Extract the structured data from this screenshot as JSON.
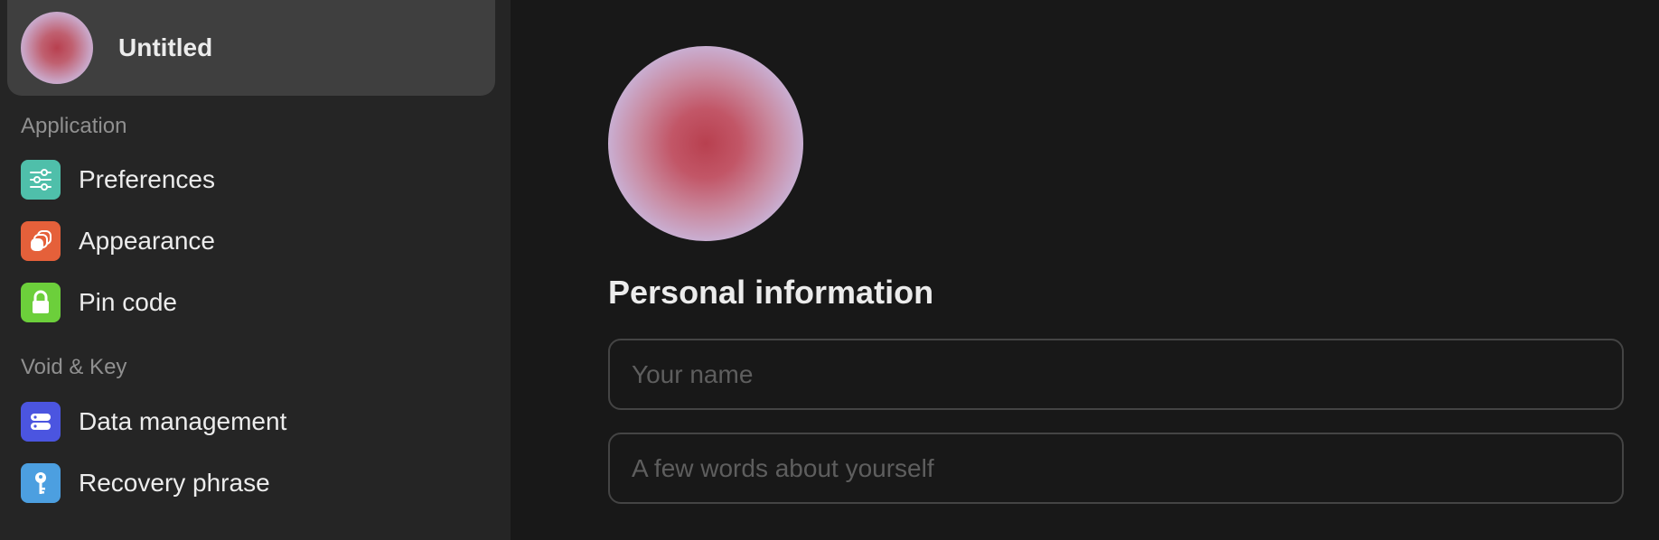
{
  "profile": {
    "name": "Untitled"
  },
  "sidebar": {
    "sections": [
      {
        "title": "Application",
        "items": [
          {
            "label": "Preferences",
            "icon": "sliders-icon",
            "color": "#4fbfaa"
          },
          {
            "label": "Appearance",
            "icon": "layers-icon",
            "color": "#e5603a"
          },
          {
            "label": "Pin code",
            "icon": "lock-icon",
            "color": "#6ccf3b"
          }
        ]
      },
      {
        "title": "Void & Key",
        "items": [
          {
            "label": "Data management",
            "icon": "database-icon",
            "color": "#4b55e0"
          },
          {
            "label": "Recovery phrase",
            "icon": "key-icon",
            "color": "#4c9fe0"
          }
        ]
      }
    ]
  },
  "main": {
    "heading": "Personal information",
    "name_placeholder": "Your name",
    "name_value": "",
    "bio_placeholder": "A few words about yourself",
    "bio_value": ""
  },
  "colors": {
    "sidebar_bg": "#252525",
    "main_bg": "#181818",
    "profile_card_bg": "#3f3f3f",
    "text": "#ececec",
    "muted": "#909090"
  }
}
